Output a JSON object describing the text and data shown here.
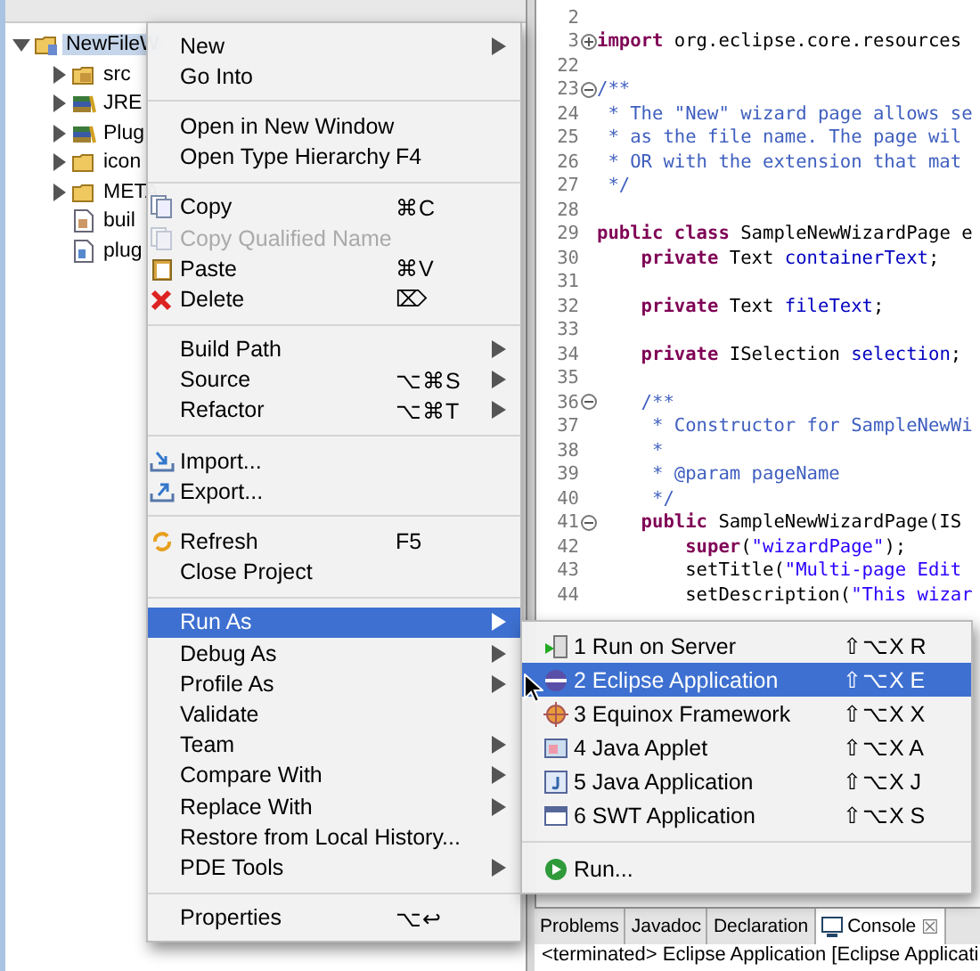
{
  "tree": [
    {
      "label": "NewFileW",
      "kind": "project",
      "expanded": true,
      "selected": true,
      "children": [
        {
          "label": "src",
          "kind": "package-folder",
          "expanded": false,
          "selected": false
        },
        {
          "label": "JRE",
          "kind": "library",
          "expanded": false,
          "selected": false
        },
        {
          "label": "Plug",
          "kind": "library",
          "expanded": false,
          "selected": false
        },
        {
          "label": "icon",
          "kind": "folder",
          "expanded": false,
          "selected": false
        },
        {
          "label": "META",
          "kind": "folder",
          "expanded": false,
          "selected": false
        },
        {
          "label": "buil",
          "kind": "file",
          "selected": false
        },
        {
          "label": "plug",
          "kind": "xml-file",
          "selected": false
        }
      ]
    }
  ],
  "editor": {
    "lines": [
      {
        "num": "2"
      },
      {
        "num": "3",
        "expanded": false,
        "tokens": [
          {
            "kind": "keyword",
            "t": "import"
          },
          {
            "kind": "plain",
            "t": " org.eclipse.core.resources"
          }
        ]
      },
      {
        "num": "22"
      },
      {
        "num": "23",
        "expanded": true,
        "tokens": [
          {
            "kind": "comment",
            "t": "/**"
          }
        ]
      },
      {
        "num": "24",
        "tokens": [
          {
            "kind": "comment",
            "t": " * The \"New\" wizard page allows se"
          }
        ]
      },
      {
        "num": "25",
        "tokens": [
          {
            "kind": "comment",
            "t": " * as the file name. The page wil"
          }
        ]
      },
      {
        "num": "26",
        "tokens": [
          {
            "kind": "comment",
            "t": " * OR with the extension that mat"
          }
        ]
      },
      {
        "num": "27",
        "tokens": [
          {
            "kind": "comment",
            "t": " */"
          }
        ]
      },
      {
        "num": "28"
      },
      {
        "num": "29",
        "tokens": [
          {
            "kind": "keyword",
            "t": "public class"
          },
          {
            "kind": "plain",
            "t": " SampleNewWizardPage e"
          }
        ]
      },
      {
        "num": "30",
        "tokens": [
          {
            "kind": "keyword",
            "t": "    private"
          },
          {
            "kind": "plain",
            "t": " Text "
          },
          {
            "kind": "field",
            "t": "containerText"
          },
          {
            "kind": "plain",
            "t": ";"
          }
        ]
      },
      {
        "num": "31"
      },
      {
        "num": "32",
        "tokens": [
          {
            "kind": "keyword",
            "t": "    private"
          },
          {
            "kind": "plain",
            "t": " Text "
          },
          {
            "kind": "field",
            "t": "fileText"
          },
          {
            "kind": "plain",
            "t": ";"
          }
        ]
      },
      {
        "num": "33"
      },
      {
        "num": "34",
        "tokens": [
          {
            "kind": "keyword",
            "t": "    private"
          },
          {
            "kind": "plain",
            "t": " ISelection "
          },
          {
            "kind": "field",
            "t": "selection"
          },
          {
            "kind": "plain",
            "t": ";"
          }
        ]
      },
      {
        "num": "35"
      },
      {
        "num": "36",
        "expanded": true,
        "tokens": [
          {
            "kind": "comment",
            "t": "    /**"
          }
        ]
      },
      {
        "num": "37",
        "tokens": [
          {
            "kind": "comment",
            "t": "     * Constructor for SampleNewWi"
          }
        ]
      },
      {
        "num": "38",
        "tokens": [
          {
            "kind": "comment",
            "t": "     *"
          }
        ]
      },
      {
        "num": "39",
        "tokens": [
          {
            "kind": "comment",
            "t": "     * @param pageName"
          }
        ]
      },
      {
        "num": "40",
        "tokens": [
          {
            "kind": "comment",
            "t": "     */"
          }
        ]
      },
      {
        "num": "41",
        "expanded": true,
        "tokens": [
          {
            "kind": "keyword",
            "t": "    public"
          },
          {
            "kind": "plain",
            "t": " SampleNewWizardPage(IS"
          }
        ]
      },
      {
        "num": "42",
        "tokens": [
          {
            "kind": "keyword",
            "t": "        super"
          },
          {
            "kind": "plain",
            "t": "("
          },
          {
            "kind": "string",
            "t": "\"wizardPage\""
          },
          {
            "kind": "plain",
            "t": ");"
          }
        ]
      },
      {
        "num": "43",
        "tokens": [
          {
            "kind": "plain",
            "t": "        setTitle("
          },
          {
            "kind": "string",
            "t": "\"Multi-page Edit"
          }
        ]
      },
      {
        "num": "44",
        "tokens": [
          {
            "kind": "plain",
            "t": "        setDescription("
          },
          {
            "kind": "string",
            "t": "\"This wizar"
          }
        ]
      }
    ]
  },
  "bottom_tabs": [
    {
      "label": "Problems",
      "kind": "plain",
      "selected": false
    },
    {
      "label": "Javadoc",
      "kind": "plain",
      "selected": false
    },
    {
      "label": "Declaration",
      "kind": "plain",
      "selected": false
    },
    {
      "label": "Console",
      "kind": "console",
      "selected": true,
      "close": "☒"
    }
  ],
  "console_line": "<terminated> Eclipse Application [Eclipse Applicati",
  "context_menu": [
    {
      "kind": "item",
      "label": "New",
      "submenu": true,
      "selected": false
    },
    {
      "kind": "item",
      "label": "Go Into",
      "selected": false
    },
    {
      "kind": "separator"
    },
    {
      "kind": "item",
      "label": "Open in New Window",
      "selected": false
    },
    {
      "kind": "item",
      "label": "Open Type Hierarchy",
      "shortcut": "F4",
      "selected": false
    },
    {
      "kind": "separator"
    },
    {
      "kind": "copy",
      "label": "Copy",
      "shortcut": "⌘C",
      "selected": false
    },
    {
      "kind": "copy",
      "label": "Copy Qualified Name",
      "disabled": true,
      "selected": false
    },
    {
      "kind": "paste",
      "label": "Paste",
      "shortcut": "⌘V",
      "selected": false
    },
    {
      "kind": "delete",
      "label": "Delete",
      "shortcut": "⌦",
      "selected": false
    },
    {
      "kind": "separator"
    },
    {
      "kind": "item",
      "label": "Build Path",
      "submenu": true,
      "selected": false
    },
    {
      "kind": "item",
      "label": "Source",
      "shortcut": "⌥⌘S",
      "submenu": true,
      "selected": false
    },
    {
      "kind": "item",
      "label": "Refactor",
      "shortcut": "⌥⌘T",
      "submenu": true,
      "selected": false
    },
    {
      "kind": "separator"
    },
    {
      "kind": "import",
      "label": "Import...",
      "selected": false
    },
    {
      "kind": "export",
      "label": "Export...",
      "selected": false
    },
    {
      "kind": "separator"
    },
    {
      "kind": "refresh",
      "label": "Refresh",
      "shortcut": "F5",
      "selected": false
    },
    {
      "kind": "item",
      "label": "Close Project",
      "selected": false
    },
    {
      "kind": "separator"
    },
    {
      "kind": "item",
      "label": "Run As",
      "submenu": true,
      "selected": true
    },
    {
      "kind": "item",
      "label": "Debug As",
      "submenu": true,
      "selected": false
    },
    {
      "kind": "item",
      "label": "Profile As",
      "submenu": true,
      "selected": false
    },
    {
      "kind": "item",
      "label": "Validate",
      "selected": false
    },
    {
      "kind": "item",
      "label": "Team",
      "submenu": true,
      "selected": false
    },
    {
      "kind": "item",
      "label": "Compare With",
      "submenu": true,
      "selected": false
    },
    {
      "kind": "item",
      "label": "Replace With",
      "submenu": true,
      "selected": false
    },
    {
      "kind": "item",
      "label": "Restore from Local History...",
      "selected": false
    },
    {
      "kind": "item",
      "label": "PDE Tools",
      "submenu": true,
      "selected": false
    },
    {
      "kind": "separator"
    },
    {
      "kind": "item",
      "label": "Properties",
      "shortcut": "⌥↩",
      "selected": false
    }
  ],
  "run_as_menu": [
    {
      "kind": "server",
      "label": "1 Run on Server",
      "shortcut": "⇧⌥X R",
      "selected": false
    },
    {
      "kind": "eclipse",
      "label": "2 Eclipse Application",
      "shortcut": "⇧⌥X E",
      "selected": true
    },
    {
      "kind": "equinox",
      "label": "3 Equinox Framework",
      "shortcut": "⇧⌥X X",
      "selected": false
    },
    {
      "kind": "applet",
      "label": "4 Java Applet",
      "shortcut": "⇧⌥X A",
      "selected": false
    },
    {
      "kind": "java",
      "label": "5 Java Application",
      "shortcut": "⇧⌥X J",
      "selected": false
    },
    {
      "kind": "swt",
      "label": "6 SWT Application",
      "shortcut": "⇧⌥X S",
      "selected": false
    },
    {
      "kind": "separator"
    },
    {
      "kind": "run",
      "label": "Run...",
      "selected": false
    }
  ]
}
